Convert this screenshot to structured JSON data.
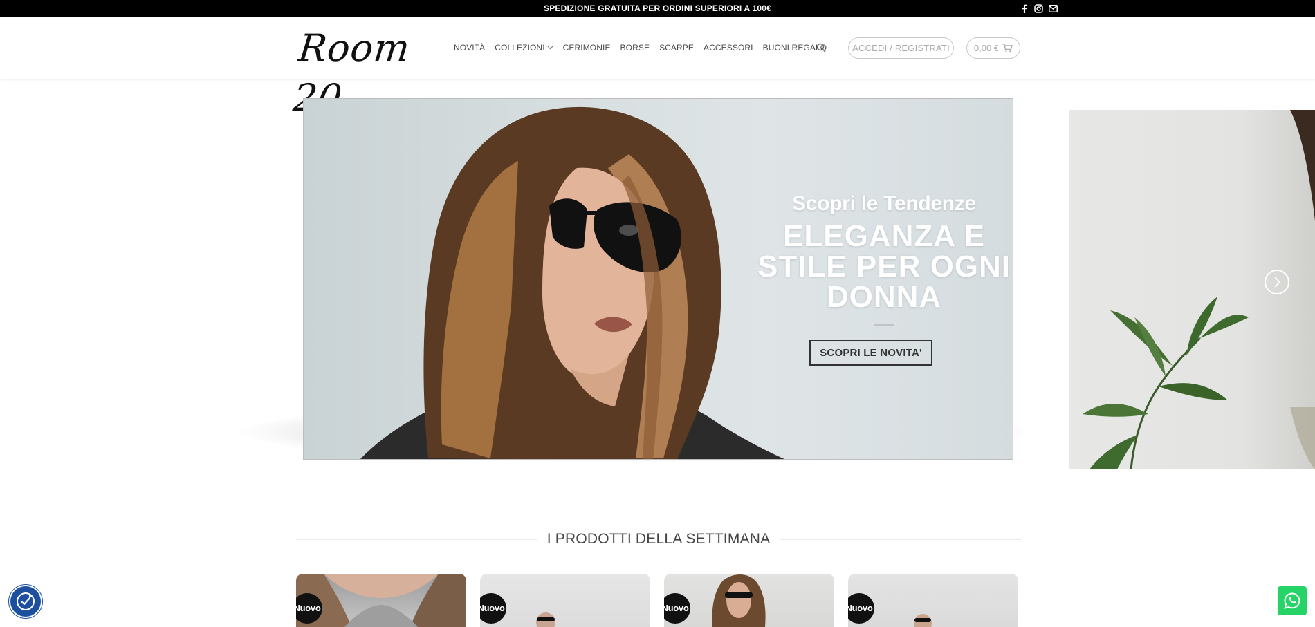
{
  "topbar": {
    "message": "SPEDIZIONE GRATUITA PER ORDINI SUPERIORI A 100€",
    "icons": [
      "facebook-icon",
      "instagram-icon",
      "email-icon"
    ]
  },
  "header": {
    "logo_text": "Room 20",
    "nav": [
      {
        "label": "NOVITÀ"
      },
      {
        "label": "COLLEZIONI"
      },
      {
        "label": "CERIMONIE"
      },
      {
        "label": "BORSE"
      },
      {
        "label": "SCARPE"
      },
      {
        "label": "ACCESSORI"
      },
      {
        "label": "BUONI REGALO"
      }
    ],
    "login_label": "ACCEDI / REGISTRATI",
    "cart_total": "0,00 €"
  },
  "slider": {
    "subtitle": "Scopri le Tendenze",
    "title_line1": "ELEGANZA E",
    "title_line2": "STILE PER OGNI",
    "title_line3": "DONNA",
    "cta_label": "SCOPRI LE NOVITA'"
  },
  "section": {
    "title": "I PRODOTTI DELLA SETTIMANA"
  },
  "products": [
    {
      "badge": "Nuovo"
    },
    {
      "badge": "Nuovo"
    },
    {
      "badge": "Nuovo"
    },
    {
      "badge": "Nuovo"
    }
  ],
  "colors": {
    "topbar_bg": "#000000",
    "accessibility_blue": "#1d4f9f",
    "whatsapp_green": "#25d366",
    "badge_bg": "#111111"
  }
}
